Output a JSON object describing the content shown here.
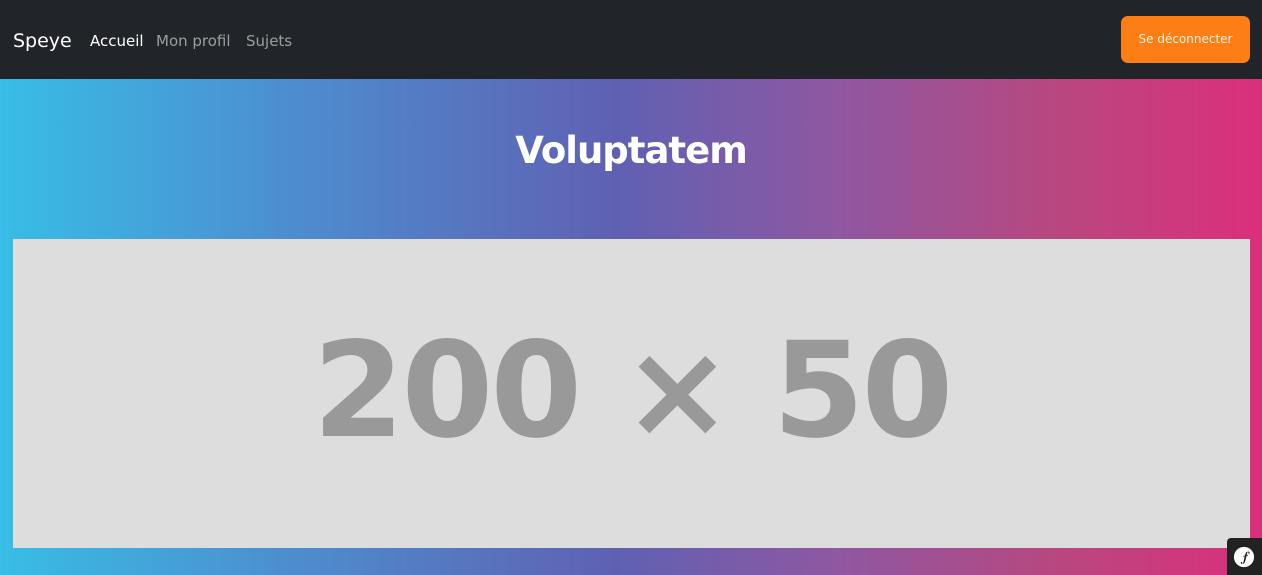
{
  "navbar": {
    "brand": "Speye",
    "links": [
      {
        "label": "Accueil",
        "active": true
      },
      {
        "label": "Mon profil",
        "active": false
      },
      {
        "label": "Sujets",
        "active": false
      }
    ],
    "logout_label": "Se déconnecter",
    "background": "#212529",
    "logout_color": "#fd7e14"
  },
  "hero": {
    "title": "Voluptatem",
    "image_placeholder_text": "200 × 50",
    "gradient_start": "#38bde6",
    "gradient_end": "#db2f7b"
  },
  "debug_toolbar": {
    "icon": "symfony-icon"
  }
}
